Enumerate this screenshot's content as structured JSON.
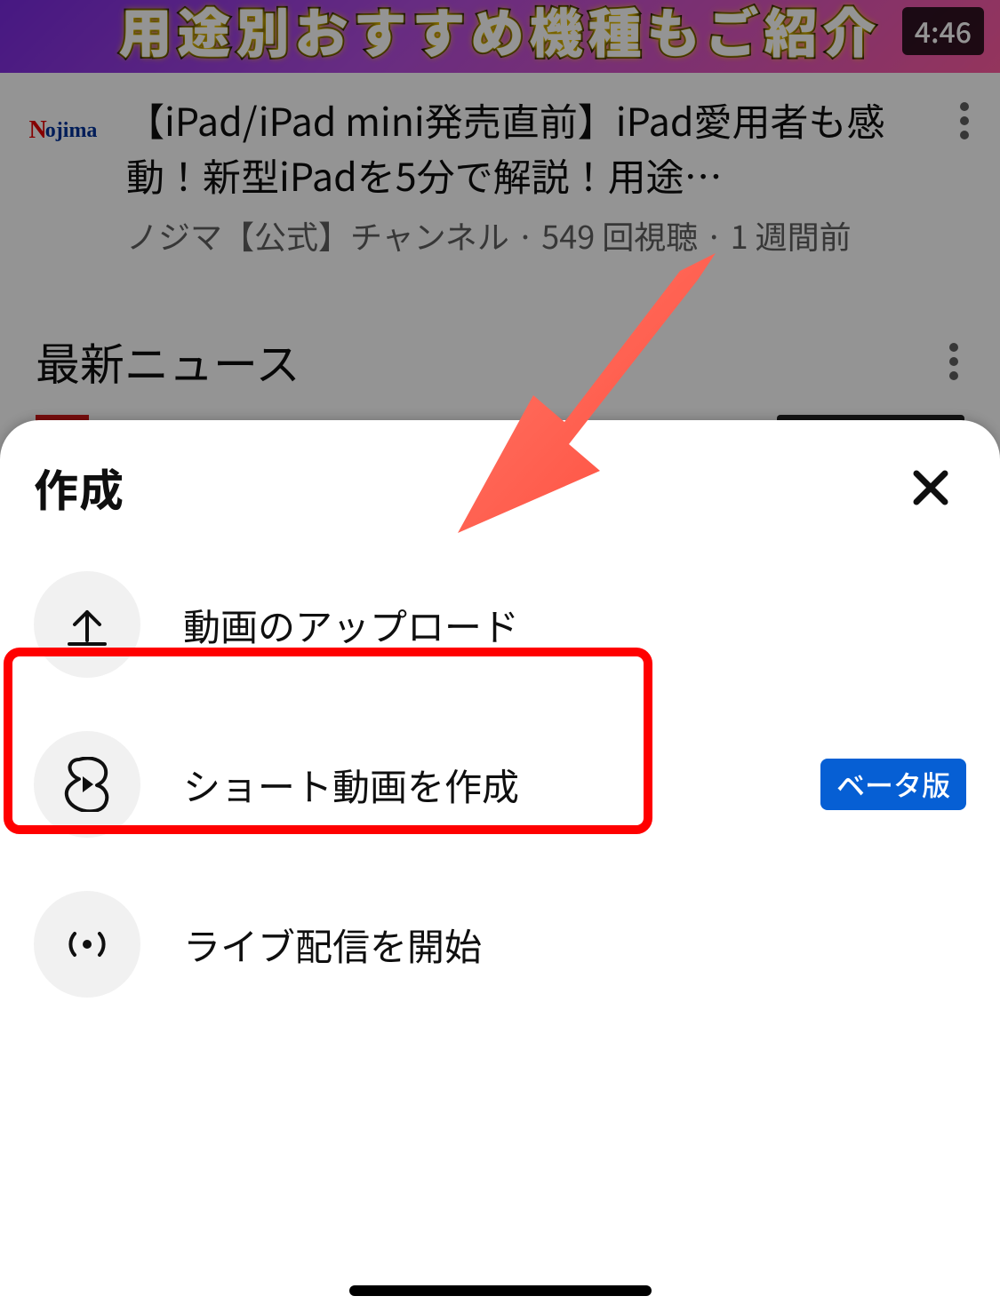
{
  "video": {
    "thumb_text": "用途別おすすめ機種もご紹介",
    "duration": "4:46",
    "channel_logo_text": "Nojima",
    "title": "【iPad/iPad mini発売直前】iPad愛用者も感動！新型iPadを5分で解説！用途…",
    "subtitle": "ノジマ【公式】チャンネル · 549 回視聴 · 1 週間前"
  },
  "section": {
    "title": "最新ニュース"
  },
  "sheet": {
    "title": "作成",
    "items": [
      {
        "label": "動画のアップロード",
        "icon": "upload",
        "highlighted": true
      },
      {
        "label": "ショート動画を作成",
        "icon": "shorts",
        "badge": "ベータ版"
      },
      {
        "label": "ライブ配信を開始",
        "icon": "live"
      }
    ]
  }
}
